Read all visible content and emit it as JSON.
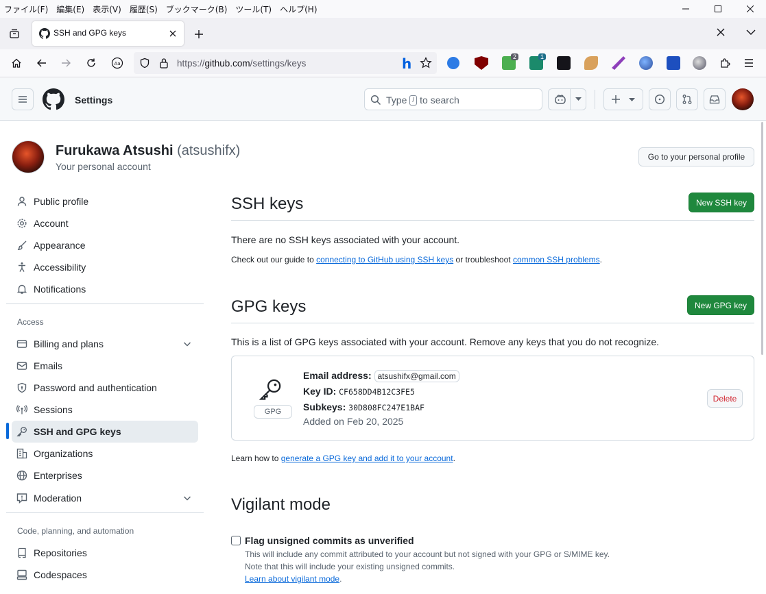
{
  "menubar": {
    "items": [
      "ファイル(F)",
      "編集(E)",
      "表示(V)",
      "履歴(S)",
      "ブックマーク(B)",
      "ツール(T)",
      "ヘルプ(H)"
    ]
  },
  "tab": {
    "title": "SSH and GPG keys"
  },
  "url": {
    "prefix": "https://",
    "host": "github.com",
    "path": "/settings/keys"
  },
  "extensions": {
    "badge_1": "2",
    "badge_2": "1"
  },
  "header": {
    "title": "Settings",
    "search_prefix": "Type",
    "search_key": "/",
    "search_suffix": "to search"
  },
  "profile": {
    "name": "Furukawa Atsushi",
    "login": "(atsushifx)",
    "subtitle": "Your personal account",
    "profile_button": "Go to your personal profile"
  },
  "sidebar": {
    "group1": [
      {
        "label": "Public profile",
        "icon": "person-icon"
      },
      {
        "label": "Account",
        "icon": "gear-icon"
      },
      {
        "label": "Appearance",
        "icon": "paintbrush-icon"
      },
      {
        "label": "Accessibility",
        "icon": "accessibility-icon"
      },
      {
        "label": "Notifications",
        "icon": "bell-icon"
      }
    ],
    "access_heading": "Access",
    "group2": [
      {
        "label": "Billing and plans",
        "icon": "credit-card-icon"
      },
      {
        "label": "Emails",
        "icon": "mail-icon"
      },
      {
        "label": "Password and authentication",
        "icon": "shield-lock-icon"
      },
      {
        "label": "Sessions",
        "icon": "broadcast-icon"
      },
      {
        "label": "SSH and GPG keys",
        "icon": "key-icon"
      },
      {
        "label": "Organizations",
        "icon": "organization-icon"
      },
      {
        "label": "Enterprises",
        "icon": "globe-icon"
      },
      {
        "label": "Moderation",
        "icon": "report-icon"
      }
    ],
    "code_heading": "Code, planning, and automation",
    "group3": [
      {
        "label": "Repositories",
        "icon": "repo-icon"
      },
      {
        "label": "Codespaces",
        "icon": "codespaces-icon"
      }
    ]
  },
  "ssh": {
    "title": "SSH keys",
    "new_button": "New SSH key",
    "empty": "There are no SSH keys associated with your account.",
    "guide_prefix": "Check out our guide to",
    "guide_link": "connecting to GitHub using SSH keys",
    "guide_middle": "or troubleshoot",
    "guide_link2": "common SSH problems",
    "guide_suffix": "."
  },
  "gpg": {
    "title": "GPG keys",
    "new_button": "New GPG key",
    "intro": "This is a list of GPG keys associated with your account. Remove any keys that you do not recognize.",
    "key": {
      "badge": "GPG",
      "email_label": "Email address:",
      "email": "atsushifx@gmail.com",
      "keyid_label": "Key ID:",
      "keyid": "CF658DD4B12C3FE5",
      "subkeys_label": "Subkeys:",
      "subkeys": "30D808FC247E1BAF",
      "added": "Added on Feb 20, 2025",
      "delete_button": "Delete"
    },
    "learn_prefix": "Learn how to",
    "learn_link": "generate a GPG key and add it to your account",
    "learn_suffix": "."
  },
  "vigilant": {
    "title": "Vigilant mode",
    "checkbox_label": "Flag unsigned commits as unverified",
    "note1": "This will include any commit attributed to your account but not signed with your GPG or S/MIME key.",
    "note2": "Note that this will include your existing unsigned commits.",
    "learn_link": "Learn about vigilant mode",
    "learn_suffix": "."
  },
  "colors": {
    "accent": "#0969da",
    "primary_button": "#1f883d",
    "danger": "#d1242f"
  }
}
